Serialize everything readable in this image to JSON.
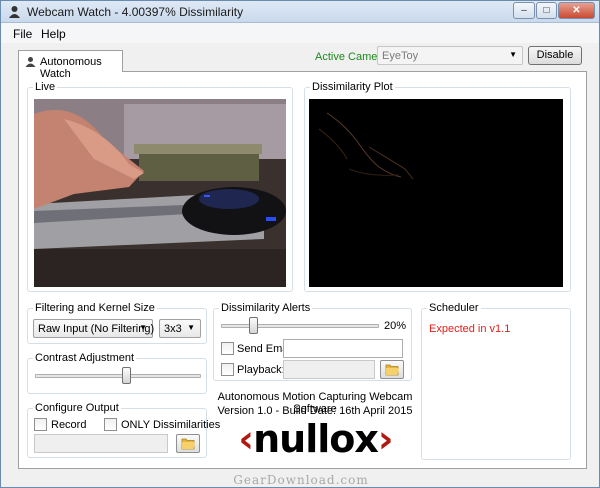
{
  "window": {
    "title": "Webcam Watch - 4.00397% Dissimilarity",
    "minimize_glyph": "–",
    "maximize_glyph": "□",
    "close_glyph": "✕"
  },
  "menu": {
    "file": "File",
    "help": "Help"
  },
  "tabs": [
    {
      "label": "Autonomous Watch",
      "icon": "camera-person-icon"
    }
  ],
  "camera": {
    "label": "Active Camera:",
    "selected": "EyeToy",
    "disable_label": "Disable"
  },
  "live": {
    "title": "Live"
  },
  "plot": {
    "title": "Dissimilarity Plot"
  },
  "filtering": {
    "title": "Filtering and Kernel Size",
    "filter_selected": "Raw Input (No Filtering)",
    "kernel_selected": "3x3"
  },
  "contrast": {
    "title": "Contrast Adjustment",
    "level": 0.55
  },
  "output": {
    "title": "Configure Output",
    "record_label": "Record",
    "only_dissim_label": "ONLY Dissimilarities",
    "record_checked": false,
    "only_checked": false
  },
  "alerts": {
    "title": "Dissimilarity Alerts",
    "slider_value_text": "20%",
    "slider_level": 0.2,
    "send_email_label": "Send Email:",
    "playback_label": "Playback:"
  },
  "about": {
    "line1": "Autonomous Motion Capturing Webcam Software",
    "line2": "Version 1.0 - Build Date: 16th April 2015",
    "logo_text": "‹nullox›"
  },
  "scheduler": {
    "title": "Scheduler",
    "status": "Expected in v1.1"
  },
  "watermark": "GearDownload.com",
  "colors": {
    "active_camera": "#1a8a1a",
    "scheduler_status": "#e0201a",
    "plot_bg": "#000000",
    "logo_accent": "#b11a12"
  }
}
